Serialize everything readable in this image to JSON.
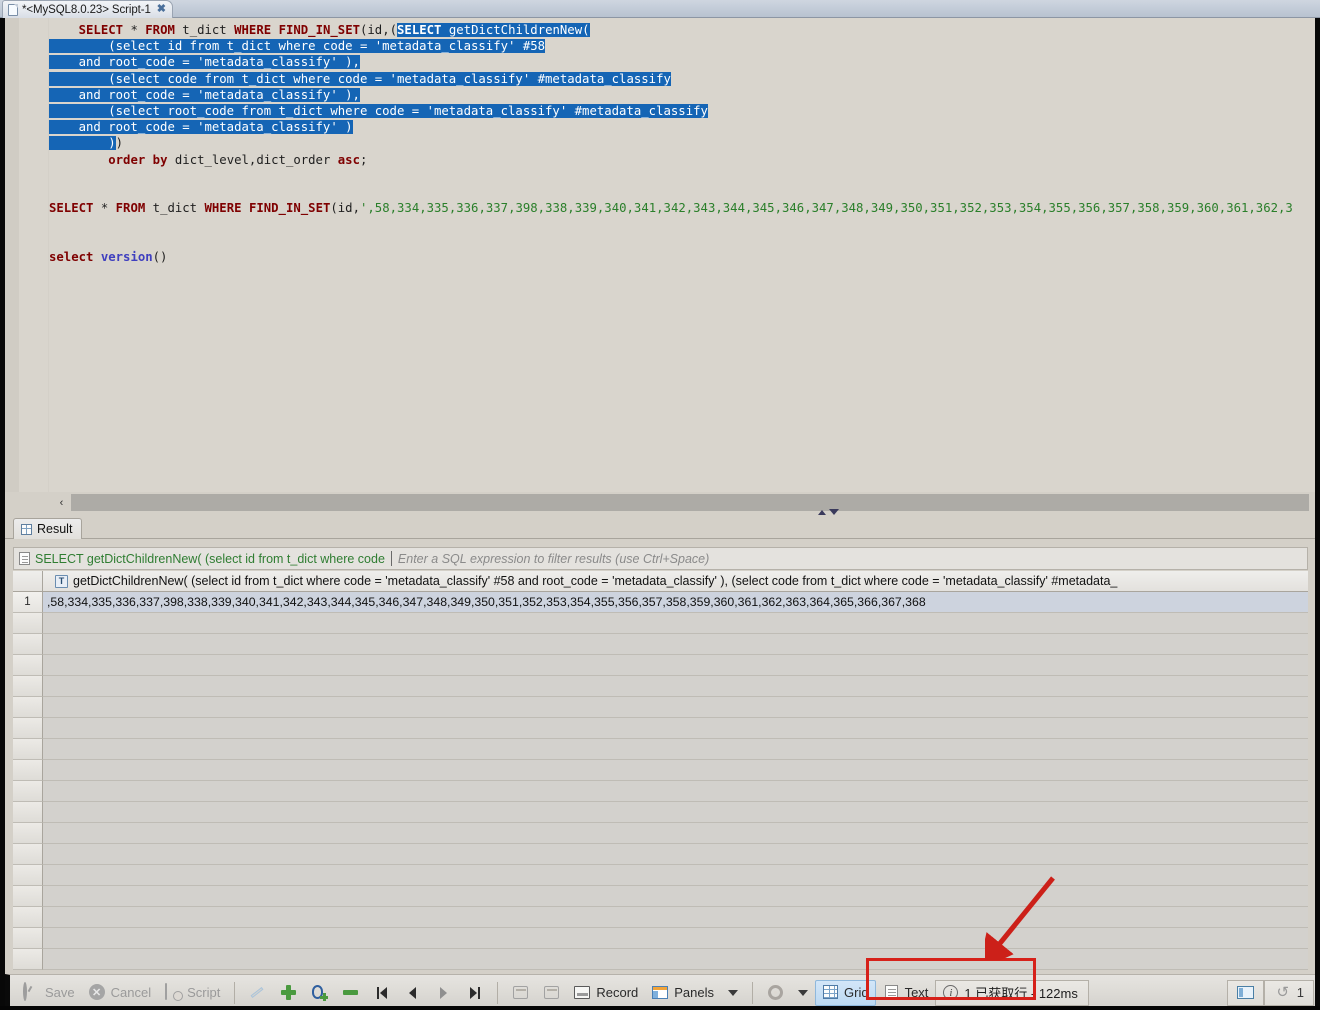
{
  "window": {
    "tab_title": "*<MySQL8.0.23> Script-1",
    "tab_close": "✖",
    "doc_icon": "document-icon"
  },
  "editor": {
    "lines": [
      {
        "selected": false,
        "tokens": [
          {
            "t": "    ",
            "c": "pl"
          },
          {
            "t": "SELECT",
            "c": "kw"
          },
          {
            "t": " * ",
            "c": "pl"
          },
          {
            "t": "FROM",
            "c": "kw"
          },
          {
            "t": " t_dict ",
            "c": "pl"
          },
          {
            "t": "WHERE",
            "c": "kw"
          },
          {
            "t": " ",
            "c": "pl"
          },
          {
            "t": "FIND_IN_SET",
            "c": "kw"
          },
          {
            "t": "(id,(",
            "c": "pl"
          }
        ],
        "sel_tokens": [
          {
            "t": "SELECT",
            "c": "kw"
          },
          {
            "t": " getDictChildrenNew(",
            "c": "pl"
          }
        ]
      },
      {
        "selected": true,
        "tokens": [
          {
            "t": "        (select id from t_dict where code = 'metadata_classify' #58",
            "c": "pl"
          }
        ]
      },
      {
        "selected": true,
        "tokens": [
          {
            "t": "    and root_code = 'metadata_classify' ),",
            "c": "pl"
          }
        ]
      },
      {
        "selected": true,
        "tokens": [
          {
            "t": "        (select code from t_dict where code = 'metadata_classify' #metadata_classify",
            "c": "pl"
          }
        ]
      },
      {
        "selected": true,
        "tokens": [
          {
            "t": "    and root_code = 'metadata_classify' ),",
            "c": "pl"
          }
        ]
      },
      {
        "selected": true,
        "tokens": [
          {
            "t": "        (select root_code from t_dict where code = 'metadata_classify' #metadata_classify",
            "c": "pl"
          }
        ]
      },
      {
        "selected": true,
        "tokens": [
          {
            "t": "    and root_code = 'metadata_classify' )",
            "c": "pl"
          }
        ]
      },
      {
        "selected": "partial",
        "tokens": [
          {
            "t": "        )",
            "c": "pl"
          }
        ],
        "after": ")"
      },
      {
        "selected": false,
        "tokens": [
          {
            "t": "        ",
            "c": "pl"
          },
          {
            "t": "order",
            "c": "kw"
          },
          {
            "t": " ",
            "c": "pl"
          },
          {
            "t": "by",
            "c": "kw"
          },
          {
            "t": " dict_level,dict_order ",
            "c": "pl"
          },
          {
            "t": "asc",
            "c": "kw"
          },
          {
            "t": ";",
            "c": "pl"
          }
        ]
      },
      {
        "selected": false,
        "tokens": []
      },
      {
        "selected": false,
        "tokens": []
      },
      {
        "selected": false,
        "tokens": [
          {
            "t": "",
            "c": "pl"
          },
          {
            "t": "SELECT",
            "c": "kw"
          },
          {
            "t": " * ",
            "c": "pl"
          },
          {
            "t": "FROM",
            "c": "kw"
          },
          {
            "t": " t_dict ",
            "c": "pl"
          },
          {
            "t": "WHERE",
            "c": "kw"
          },
          {
            "t": " ",
            "c": "pl"
          },
          {
            "t": "FIND_IN_SET",
            "c": "kw"
          },
          {
            "t": "(id,",
            "c": "pl"
          },
          {
            "t": "',58,334,335,336,337,398,338,339,340,341,342,343,344,345,346,347,348,349,350,351,352,353,354,355,356,357,358,359,360,361,362,3",
            "c": "num"
          }
        ]
      },
      {
        "selected": false,
        "tokens": []
      },
      {
        "selected": false,
        "tokens": []
      },
      {
        "selected": false,
        "tokens": [
          {
            "t": "",
            "c": "pl"
          },
          {
            "t": "select",
            "c": "kw"
          },
          {
            "t": " ",
            "c": "pl"
          },
          {
            "t": "version",
            "c": "kw2"
          },
          {
            "t": "()",
            "c": "pl"
          }
        ]
      }
    ],
    "hscroll_left_arrow": "‹"
  },
  "result": {
    "tab_label": "Result",
    "tab_icon": "grid-icon",
    "filter": {
      "icon": "document-icon",
      "query": "SELECT getDictChildrenNew( (select id from t_dict where code",
      "placeholder": "Enter a SQL expression to filter results (use Ctrl+Space)"
    },
    "grid": {
      "type_badge": "T",
      "column_header": "getDictChildrenNew(        (select id from t_dict where code = 'metadata_classify' #58      and root_code = 'metadata_classify' ),          (select code from t_dict where code = 'metadata_classify' #metadata_",
      "rows": [
        {
          "num": "1",
          "value": ",58,334,335,336,337,398,338,339,340,341,342,343,344,345,346,347,348,349,350,351,352,353,354,355,356,357,358,359,360,361,362,363,364,365,366,367,368",
          "selected": true
        }
      ],
      "empty_row_count": 17
    }
  },
  "toolbar": {
    "save": {
      "label": "Save",
      "icon": "save-clock-icon",
      "disabled": true
    },
    "cancel": {
      "label": "Cancel",
      "icon": "cancel-icon",
      "disabled": true
    },
    "script": {
      "label": "Script",
      "icon": "script-icon",
      "disabled": true
    },
    "edit_cell": {
      "icon": "pencil-icon"
    },
    "add_row": {
      "icon": "plus-icon"
    },
    "duplicate_row": {
      "icon": "duplicate-row-icon"
    },
    "delete_row": {
      "icon": "minus-icon"
    },
    "nav_first": {
      "icon": "first-row-icon"
    },
    "nav_prev": {
      "icon": "previous-row-icon"
    },
    "nav_next": {
      "icon": "next-row-icon"
    },
    "nav_last": {
      "icon": "last-row-icon"
    },
    "export_a": {
      "icon": "export-sheet-icon"
    },
    "export_b": {
      "icon": "import-sheet-icon"
    },
    "record": {
      "label": "Record",
      "icon": "record-icon"
    },
    "panels": {
      "label": "Panels",
      "icon": "panels-icon",
      "caret": "chevron-down-icon"
    },
    "settings": {
      "icon": "gear-icon",
      "caret": "chevron-down-icon"
    },
    "grid_view": {
      "label": "Grid",
      "icon": "grid-icon",
      "active": true
    },
    "text_view": {
      "label": "Text",
      "icon": "text-icon",
      "active": false
    },
    "status": {
      "icon": "info-icon",
      "text": "1 已获取行 - 122ms"
    },
    "panel_toggle": {
      "icon": "panel-toggle-icon"
    },
    "refresh": {
      "icon": "refresh-icon",
      "count": "1"
    }
  },
  "annotations": {
    "highlight_box_color": "#d6211a",
    "arrow_color": "#cc2019"
  }
}
